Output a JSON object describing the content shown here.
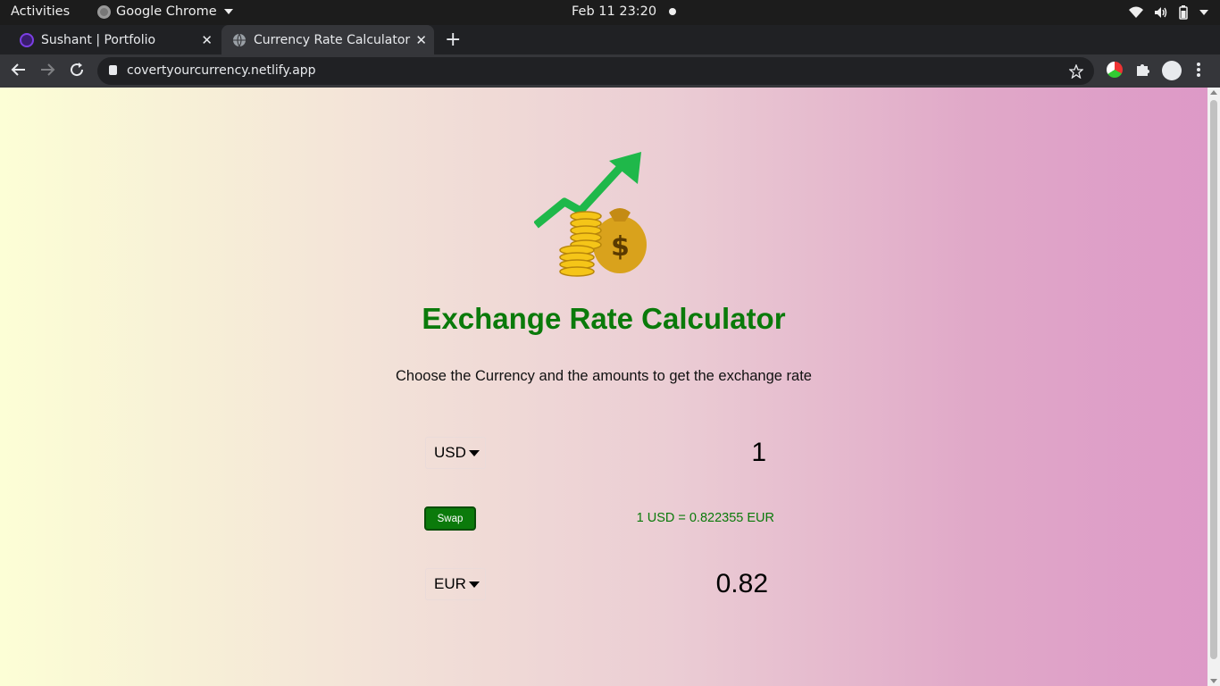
{
  "system_bar": {
    "activities": "Activities",
    "app_name": "Google Chrome",
    "datetime": "Feb 11  23:20"
  },
  "tabs": [
    {
      "title": "Sushant | Portfolio",
      "close": "✕"
    },
    {
      "title": "Currency Rate Calculator",
      "close": "✕"
    }
  ],
  "new_tab": "+",
  "toolbar": {
    "url": "covertyourcurrency.netlify.app"
  },
  "page": {
    "title": "Exchange Rate Calculator",
    "subtitle": "Choose the Currency and the amounts to get the exchange rate",
    "currency_one": "USD",
    "amount_one": "1",
    "swap_label": "Swap",
    "rate_text": "1 USD = 0.822355 EUR",
    "currency_two": "EUR",
    "amount_two": "0.82"
  },
  "colors": {
    "accent_green": "#0a7a0a",
    "gradient_left": "#fcfed6",
    "gradient_right": "#dd98c7"
  }
}
